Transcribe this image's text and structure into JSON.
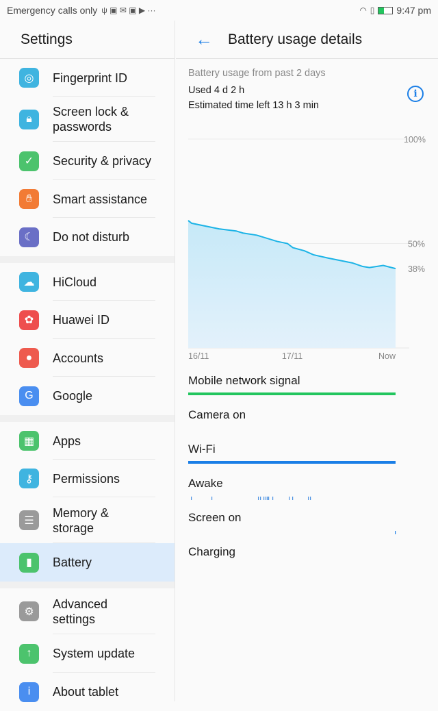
{
  "status": {
    "carrier": "Emergency calls only",
    "icons": [
      "usb-icon",
      "facebook-icon",
      "gmail-icon",
      "facebook-icon",
      "play-icon",
      "more-icon"
    ],
    "right_icons": [
      "wifi-icon",
      "sim-alert-icon",
      "battery-charging-icon"
    ],
    "time": "9:47 pm"
  },
  "sidebar": {
    "title": "Settings",
    "groups": [
      {
        "items": [
          {
            "label": "Fingerprint ID",
            "icon": "fingerprint-icon",
            "color": "#3fb4e0",
            "h": 55
          },
          {
            "label": "Screen lock &\npasswords",
            "icon": "lock-icon",
            "color": "#3fb4e0",
            "h": 66
          },
          {
            "label": "Security & privacy",
            "icon": "shield-icon",
            "color": "#4cc36d",
            "h": 56
          },
          {
            "label": "Smart assistance",
            "icon": "hand-icon",
            "color": "#f27b35",
            "h": 55
          },
          {
            "label": "Do not disturb",
            "icon": "moon-icon",
            "color": "#6a6fc6",
            "h": 56
          }
        ]
      },
      {
        "items": [
          {
            "label": "HiCloud",
            "icon": "cloud-icon",
            "color": "#3fb4e0",
            "h": 55
          },
          {
            "label": "Huawei ID",
            "icon": "huawei-icon",
            "color": "#ee4e4e",
            "h": 56
          },
          {
            "label": "Accounts",
            "icon": "account-icon",
            "color": "#ee5a4e",
            "h": 55
          },
          {
            "label": "Google",
            "icon": "google-icon",
            "color": "#4a8ef0",
            "h": 56
          }
        ]
      },
      {
        "items": [
          {
            "label": "Apps",
            "icon": "apps-icon",
            "color": "#4cc36d",
            "h": 55
          },
          {
            "label": "Permissions",
            "icon": "key-icon",
            "color": "#3fb4e0",
            "h": 55
          },
          {
            "label": "Memory &\nstorage",
            "icon": "storage-icon",
            "color": "#9a9a9a",
            "h": 67
          },
          {
            "label": "Battery",
            "icon": "battery-icon",
            "color": "#4cc36d",
            "h": 56,
            "selected": true
          }
        ]
      },
      {
        "items": [
          {
            "label": "Advanced\nsettings",
            "icon": "gear-icon",
            "color": "#9a9a9a",
            "h": 67
          },
          {
            "label": "System update",
            "icon": "update-icon",
            "color": "#4cc36d",
            "h": 56
          },
          {
            "label": "About tablet",
            "icon": "info-icon",
            "color": "#4a8ef0",
            "h": 56
          }
        ]
      }
    ]
  },
  "detail": {
    "title": "Battery usage details",
    "subtitle": "Battery usage from past 2 days",
    "used": "Used 4 d 2 h",
    "estimated": "Estimated time left 13 h 3 min"
  },
  "chart_data": {
    "type": "area",
    "ylim": [
      0,
      100
    ],
    "yticks": [
      "100%",
      "50%"
    ],
    "end_label": "38%",
    "xticks": [
      "16/11",
      "17/11",
      "Now"
    ],
    "xrange": [
      "16/11 00:00",
      "17/11 23:50"
    ],
    "line_color": "#1bb3e6",
    "x": [
      "16/11 00:00",
      "16/11 00:47",
      "16/11 07:06",
      "16/11 11:03",
      "16/11 12:38",
      "16/11 15:47",
      "16/11 20:31",
      "16/11 22:53",
      "17/11 00:09",
      "17/11 02:50",
      "17/11 04:53",
      "17/11 08:21",
      "17/11 13:52",
      "17/11 16:15",
      "17/11 17:49",
      "17/11 20:59",
      "17/11 23:50"
    ],
    "y": [
      61,
      59.7,
      57,
      56,
      55,
      54,
      51,
      50,
      48,
      46.5,
      44.6,
      43,
      40.7,
      39,
      38.5,
      39.5,
      38
    ]
  },
  "timelines": [
    {
      "label": "Mobile network signal",
      "color": "#22c55e",
      "segments": [
        [
          "16/11 00:00",
          "17/11 23:50"
        ]
      ]
    },
    {
      "label": "Camera on",
      "color": "#1a7ee6",
      "segments": []
    },
    {
      "label": "Wi-Fi",
      "color": "#1a7ee6",
      "segments": [
        [
          "16/11 00:00",
          "17/11 23:50"
        ]
      ]
    },
    {
      "label": "Awake",
      "color": "#4a90e2",
      "ticks": [
        "16/11 00:38",
        "16/11 05:22",
        "16/11 16:06",
        "16/11 16:35",
        "16/11 17:22",
        "16/11 17:50",
        "16/11 18:09",
        "16/11 18:28",
        "16/11 19:25",
        "16/11 23:13",
        "17/11 00:00",
        "17/11 03:38",
        "17/11 04:06"
      ]
    },
    {
      "label": "Screen on",
      "color": "#1a7ee6",
      "ticks": [
        "17/11 23:41"
      ]
    },
    {
      "label": "Charging",
      "color": "#1a7ee6",
      "segments": []
    }
  ]
}
